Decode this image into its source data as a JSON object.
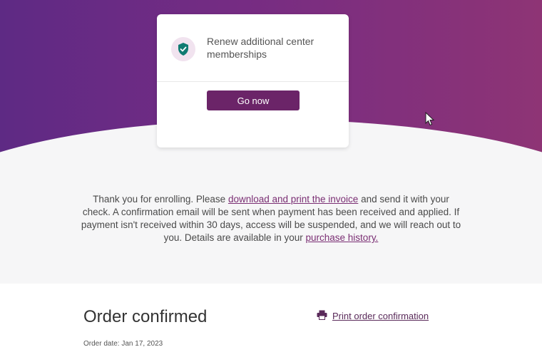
{
  "colors": {
    "hero_gradient_start": "#5e2a84",
    "hero_gradient_end": "#8e3475",
    "button_bg": "#6b2468",
    "link": "#7a2e73",
    "badge_shield": "#0f7b72"
  },
  "card": {
    "icon": "shield-check-icon",
    "title": "Renew additional center memberships",
    "button_label": "Go now"
  },
  "message": {
    "part1": "Thank you for enrolling. Please ",
    "invoice_link": "download and print the invoice",
    "part2": " and send it with your check. A confirmation email will be sent when payment has been received and applied. If payment isn't received within 30 days, access will be suspended, and we will reach out to you. Details are available in your ",
    "history_link": "purchase history."
  },
  "order": {
    "title": "Order confirmed",
    "print_icon": "printer-icon",
    "print_label": "Print order confirmation",
    "date": "Order date: Jan 17, 2023"
  }
}
